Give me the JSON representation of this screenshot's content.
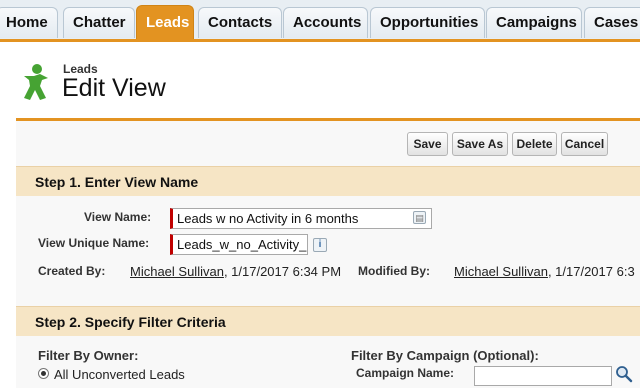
{
  "tabs": [
    {
      "label": "Home",
      "active": false
    },
    {
      "label": "Chatter",
      "active": false
    },
    {
      "label": "Leads",
      "active": true
    },
    {
      "label": "Contacts",
      "active": false
    },
    {
      "label": "Accounts",
      "active": false
    },
    {
      "label": "Opportunities",
      "active": false
    },
    {
      "label": "Campaigns",
      "active": false
    },
    {
      "label": "Cases",
      "active": false
    }
  ],
  "header": {
    "object_label": "Leads",
    "title": "Edit View",
    "icon": "leads-person-icon"
  },
  "buttons": {
    "save": "Save",
    "save_as": "Save As",
    "delete": "Delete",
    "cancel": "Cancel"
  },
  "step1": {
    "title": "Step 1. Enter View Name",
    "view_name_label": "View Name:",
    "view_name_value": "Leads w no Activity in 6 months",
    "unique_name_label": "View Unique Name:",
    "unique_name_value": "Leads_w_no_Activity_in",
    "created_by_label": "Created By:",
    "created_by_user": "Michael Sullivan",
    "created_by_date": ", 1/17/2017 6:34 PM",
    "modified_by_label": "Modified By:",
    "modified_by_user": "Michael Sullivan",
    "modified_by_date": ", 1/17/2017 6:3"
  },
  "step2": {
    "title": "Step 2. Specify Filter Criteria",
    "filter_owner_label": "Filter By Owner:",
    "owner_option": "All Unconverted Leads",
    "filter_campaign_label": "Filter By Campaign (Optional):",
    "campaign_name_label": "Campaign Name:",
    "campaign_name_value": ""
  },
  "colors": {
    "accent": "#e39321",
    "step_bg": "#f6e5c5",
    "tabbar_bg": "#e8eef3",
    "required": "#c00000"
  }
}
